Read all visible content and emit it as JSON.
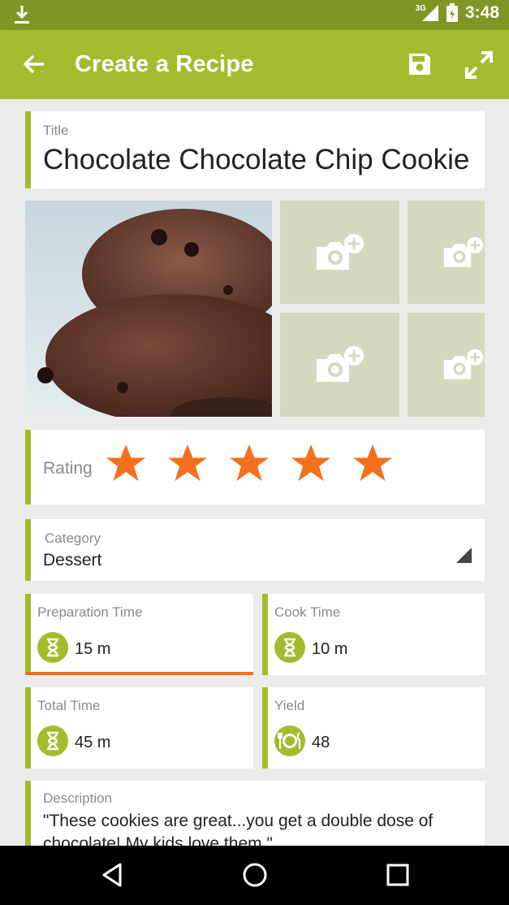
{
  "status_bar": {
    "time": "3:48",
    "network": "3G",
    "icons": [
      "download-icon",
      "signal-icon",
      "battery-icon"
    ]
  },
  "app_bar": {
    "title": "Create a Recipe",
    "actions": [
      "save-icon",
      "expand-icon"
    ]
  },
  "title_field": {
    "label": "Title",
    "value": "Chocolate Chocolate Chip Cookie"
  },
  "photos": {
    "main_description": "chocolate cookie photo",
    "add_photo_icon": "camera-plus-icon",
    "empty_slots": 4
  },
  "rating": {
    "label": "Rating",
    "value": 5,
    "max": 5
  },
  "category": {
    "label": "Category",
    "value": "Dessert"
  },
  "prep_time": {
    "label": "Preparation Time",
    "value": "15 m"
  },
  "cook_time": {
    "label": "Cook Time",
    "value": "10 m"
  },
  "total_time": {
    "label": "Total Time",
    "value": "45 m"
  },
  "yield": {
    "label": "Yield",
    "value": "48"
  },
  "description": {
    "label": "Description",
    "value": "\"These cookies are great...you get a double dose of chocolate! My kids love them.\""
  },
  "colors": {
    "accent": "#a4bb2e",
    "status_bar": "#7f9624",
    "star": "#f4701d",
    "tile": "#d3d9bd"
  }
}
